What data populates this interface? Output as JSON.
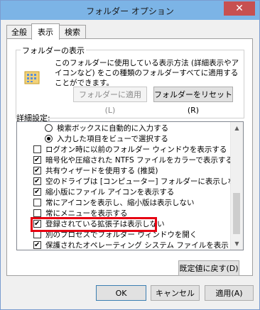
{
  "window": {
    "title": "フォルダー オプション",
    "close_glyph": "✕"
  },
  "tabs": [
    {
      "label": "全般"
    },
    {
      "label": "表示",
      "active": true
    },
    {
      "label": "検索"
    }
  ],
  "folder_view": {
    "group_label": "フォルダーの表示",
    "description": "このフォルダーに使用している表示方法 (詳細表示やアイコンなど) をこの種類のフォルダーすべてに適用することができます。",
    "apply_label": "フォルダーに適用(L)",
    "reset_label": "フォルダーをリセット(R)"
  },
  "advanced": {
    "label": "詳細設定:",
    "items": [
      {
        "type": "radio",
        "checked": false,
        "label": "検索ボックスに自動的に入力する"
      },
      {
        "type": "radio",
        "checked": true,
        "label": "入力した項目をビューで選択する"
      },
      {
        "type": "checkbox",
        "checked": false,
        "label": "ログオン時に以前のフォルダー ウィンドウを表示する"
      },
      {
        "type": "checkbox",
        "checked": true,
        "label": "暗号化や圧縮された NTFS ファイルをカラーで表示する"
      },
      {
        "type": "checkbox",
        "checked": true,
        "label": "共有ウィザードを使用する (推奨)"
      },
      {
        "type": "checkbox",
        "checked": true,
        "label": "空のドライブは [コンピューター] フォルダーに表示しない"
      },
      {
        "type": "checkbox",
        "checked": true,
        "label": "縮小版にファイル アイコンを表示する"
      },
      {
        "type": "checkbox",
        "checked": false,
        "label": "常にアイコンを表示し、縮小版は表示しない"
      },
      {
        "type": "checkbox",
        "checked": false,
        "label": "常にメニューを表示する"
      },
      {
        "type": "checkbox",
        "checked": true,
        "label": "登録されている拡張子は表示しない"
      },
      {
        "type": "checkbox",
        "checked": false,
        "label": "別のプロセスでフォルダー ウィンドウを開く"
      },
      {
        "type": "checkbox",
        "checked": true,
        "label": "保護されたオペレーティング システム ファイルを表示しない (推奨)"
      }
    ],
    "restore_label": "既定値に戻す(D)"
  },
  "footer": {
    "ok_label": "OK",
    "cancel_label": "キャンセル",
    "apply_label": "適用(A)"
  },
  "colors": {
    "title_bar": "#7cb4e6",
    "close_button": "#c75050",
    "highlight": "#e60012"
  }
}
